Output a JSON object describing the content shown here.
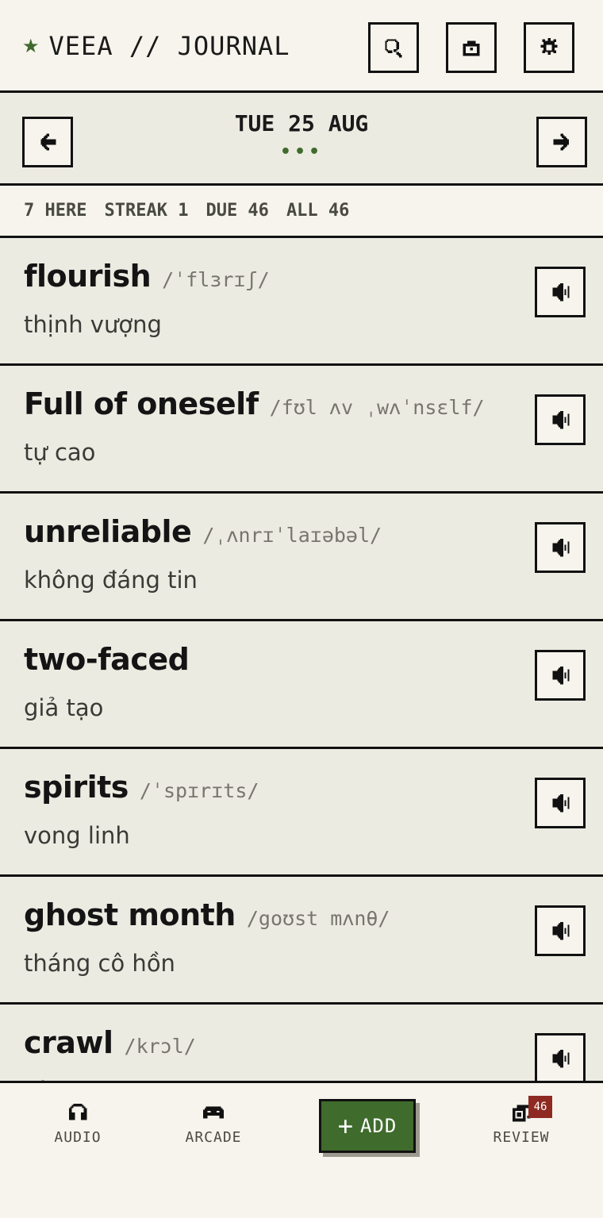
{
  "header": {
    "title": "VEEA // JOURNAL",
    "buttons": [
      "search",
      "camera",
      "settings"
    ]
  },
  "date_bar": {
    "date": "TUE 25 AUG",
    "dots": "•••"
  },
  "stats": [
    {
      "label": "7 HERE"
    },
    {
      "label": "STREAK 1"
    },
    {
      "label": "DUE 46"
    },
    {
      "label": "ALL 46"
    }
  ],
  "words": [
    {
      "term": "flourish",
      "ipa": "/ˈflɜrɪʃ/",
      "meaning": "thịnh vượng"
    },
    {
      "term": "Full of oneself",
      "ipa": "/fʊl ʌv ˌwʌˈnsɛlf/",
      "meaning": "tự cao"
    },
    {
      "term": "unreliable",
      "ipa": "/ˌʌnrɪˈlaɪəbəl/",
      "meaning": "không đáng tin"
    },
    {
      "term": "two-faced",
      "ipa": "",
      "meaning": "giả tạo"
    },
    {
      "term": "spirits",
      "ipa": "/ˈspɪrɪts/",
      "meaning": "vong linh"
    },
    {
      "term": "ghost month",
      "ipa": "/goʊst mʌnθ/",
      "meaning": "tháng cô hồn"
    },
    {
      "term": "crawl",
      "ipa": "/krɔl/",
      "meaning": "bò"
    }
  ],
  "bottom_nav": {
    "audio": "AUDIO",
    "arcade": "ARCADE",
    "add": "ADD",
    "review": "REVIEW",
    "review_badge": "46"
  },
  "colors": {
    "accent": "#3f6b2c",
    "badge": "#8e2a22",
    "background": "#f6f4ec",
    "card": "#ecebe2"
  }
}
